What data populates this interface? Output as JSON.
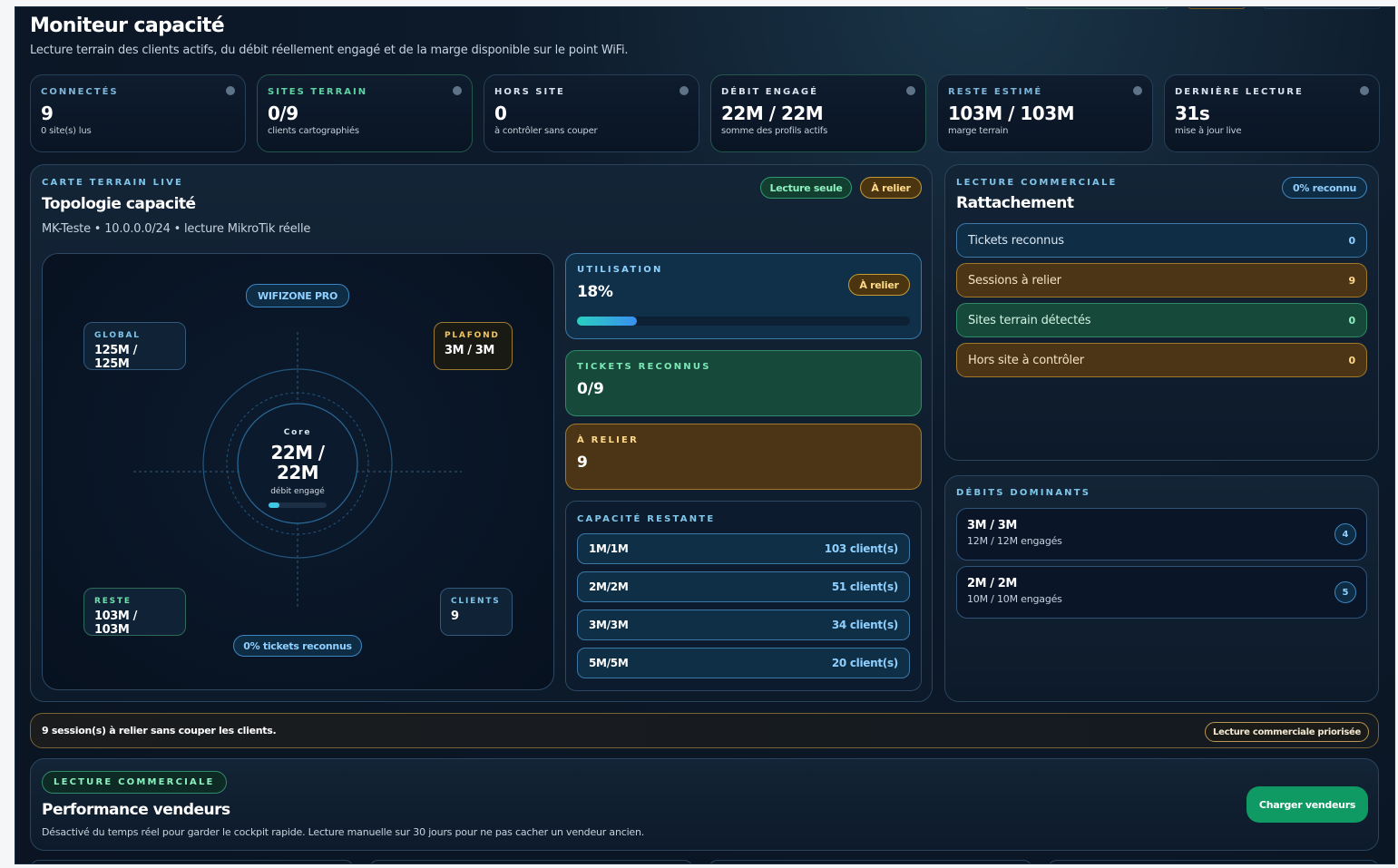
{
  "header": {
    "title": "Moniteur capacité",
    "subtitle": "Lecture terrain des clients actifs, du débit réellement engagé et de la marge disponible sur le point WiFi."
  },
  "kpis": [
    {
      "label": "Connectés",
      "value": "9",
      "sub": "0 site(s) lus"
    },
    {
      "label": "Sites terrain",
      "value": "0/9",
      "sub": "clients cartographiés"
    },
    {
      "label": "Hors site",
      "value": "0",
      "sub": "à contrôler sans couper"
    },
    {
      "label": "Débit engagé",
      "value": "22M / 22M",
      "sub": "somme des profils actifs"
    },
    {
      "label": "Reste estimé",
      "value": "103M / 103M",
      "sub": "marge terrain"
    },
    {
      "label": "Dernière lecture",
      "value": "31s",
      "sub": "mise à jour live"
    }
  ],
  "topology": {
    "eyebrow": "Carte terrain live",
    "title": "Topologie capacité",
    "subtitle": "MK-Teste • 10.0.0.0/24 • lecture MikroTik réelle",
    "pill_readonly": "Lecture seule",
    "pill_relier": "À relier",
    "network_name": "WIFIZONE PRO",
    "global": {
      "label": "Global",
      "value": "125M / 125M"
    },
    "plafond": {
      "label": "Plafond",
      "value": "3M / 3M"
    },
    "reste": {
      "label": "Reste",
      "value": "103M / 103M"
    },
    "clients": {
      "label": "Clients",
      "value": "9"
    },
    "core": {
      "label": "Core",
      "value": "22M / 22M",
      "sub": "débit engagé",
      "fill_fraction": 0.18
    },
    "tickets_pill": "0% tickets reconnus"
  },
  "utilisation": {
    "label": "Utilisation",
    "value": "18%",
    "pill": "À relier",
    "fill_fraction": 0.18
  },
  "tickets": {
    "label": "Tickets reconnus",
    "value": "0/9"
  },
  "relier": {
    "label": "À relier",
    "value": "9"
  },
  "capacite": {
    "label": "Capacité restante",
    "rows": [
      {
        "profile": "1M/1M",
        "clients": "103 client(s)"
      },
      {
        "profile": "2M/2M",
        "clients": "51 client(s)"
      },
      {
        "profile": "3M/3M",
        "clients": "34 client(s)"
      },
      {
        "profile": "5M/5M",
        "clients": "20 client(s)"
      }
    ]
  },
  "rattachement": {
    "eyebrow": "Lecture commerciale",
    "title": "Rattachement",
    "pill": "0% reconnu",
    "rows": [
      {
        "label": "Tickets reconnus",
        "value": "0"
      },
      {
        "label": "Sessions à relier",
        "value": "9"
      },
      {
        "label": "Sites terrain détectés",
        "value": "0"
      },
      {
        "label": "Hors site à contrôler",
        "value": "0"
      }
    ]
  },
  "debits": {
    "eyebrow": "Débits dominants",
    "items": [
      {
        "title": "3M / 3M",
        "sub": "12M / 12M engagés",
        "count": "4"
      },
      {
        "title": "2M / 2M",
        "sub": "10M / 10M engagés",
        "count": "5"
      }
    ]
  },
  "alert": {
    "text": "9 session(s) à relier sans couper les clients.",
    "pill": "Lecture commerciale priorisée"
  },
  "vendeurs": {
    "tag": "Lecture commerciale",
    "title": "Performance vendeurs",
    "subtitle": "Désactivé du temps réel pour garder le cockpit rapide. Lecture manuelle sur 30 jours pour ne pas cacher un vendeur ancien.",
    "button": "Charger vendeurs"
  },
  "colors": {
    "accent_blue": "#3b86c2",
    "accent_green": "#2f9a6e",
    "accent_amber": "#c59a35",
    "button_green": "#0f9a63"
  }
}
